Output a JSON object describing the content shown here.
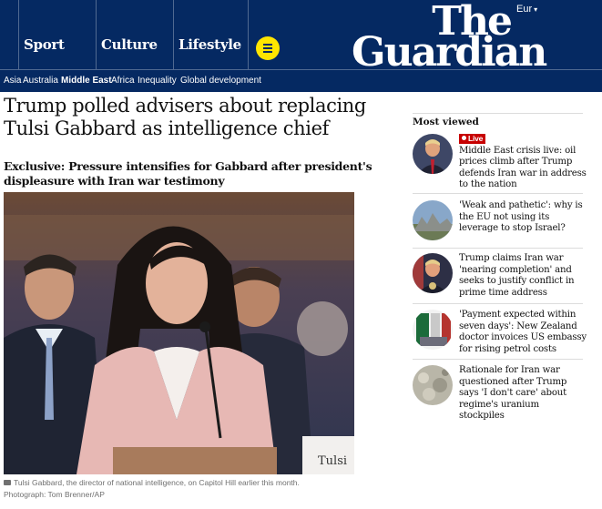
{
  "header": {
    "edition": "Eur",
    "logo_the": "The",
    "logo_guardian": "Guardian",
    "pillars": [
      {
        "label": "Sport"
      },
      {
        "label": "Culture"
      },
      {
        "label": "Lifestyle"
      }
    ]
  },
  "subnav": [
    {
      "label": "Asia"
    },
    {
      "label": "Australia"
    },
    {
      "label": "Middle East",
      "active": true
    },
    {
      "label": "Africa"
    },
    {
      "label": "Inequality"
    },
    {
      "label": "Global development"
    }
  ],
  "article": {
    "headline": "Trump polled advisers about replacing Tulsi Gabbard as intelligence chief",
    "standfirst": "Exclusive: Pressure intensifies for Gabbard after president's displeasure with Iran war testimony",
    "nameplate": "Tulsi",
    "caption": "Tulsi Gabbard, the director of national intelligence, on Capitol Hill earlier this month.",
    "credit": "Photograph: Tom Brenner/AP"
  },
  "most_viewed": {
    "title": "Most viewed",
    "live_label": "Live",
    "items": [
      {
        "text": "Middle East crisis live: oil prices climb after Trump defends Iran war in address to the nation",
        "live": true
      },
      {
        "text": "'Weak and pathetic': why is the EU not using its leverage to stop Israel?"
      },
      {
        "text": "Trump claims Iran war 'nearing completion' and seeks to justify conflict in prime time address"
      },
      {
        "text": "'Payment expected within seven days': New Zealand doctor invoices US embassy for rising petrol costs"
      },
      {
        "text": "Rationale for Iran war questioned after Trump says 'I don't care' about regime's uranium stockpiles"
      }
    ]
  },
  "colors": {
    "brand_navy": "#052962",
    "menu_yellow": "#ffe500",
    "live_red": "#c70000"
  },
  "icons": [
    "menu-icon",
    "camera-icon",
    "chevron-down-icon"
  ]
}
